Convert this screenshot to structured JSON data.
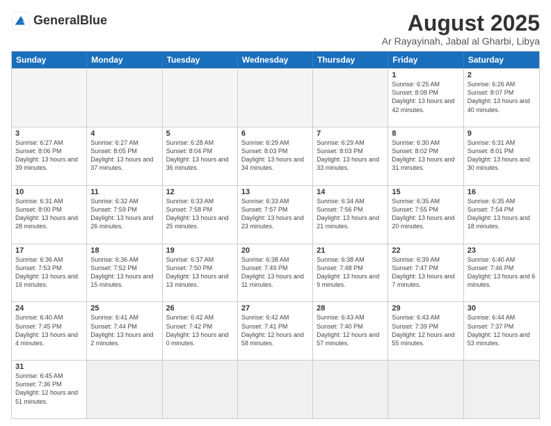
{
  "header": {
    "logo_general": "General",
    "logo_blue": "Blue",
    "month_year": "August 2025",
    "location": "Ar Rayayinah, Jabal al Gharbi, Libya"
  },
  "weekdays": [
    "Sunday",
    "Monday",
    "Tuesday",
    "Wednesday",
    "Thursday",
    "Friday",
    "Saturday"
  ],
  "weeks": [
    [
      {
        "day": "",
        "info": ""
      },
      {
        "day": "",
        "info": ""
      },
      {
        "day": "",
        "info": ""
      },
      {
        "day": "",
        "info": ""
      },
      {
        "day": "",
        "info": ""
      },
      {
        "day": "1",
        "info": "Sunrise: 6:25 AM\nSunset: 8:08 PM\nDaylight: 13 hours and 42 minutes."
      },
      {
        "day": "2",
        "info": "Sunrise: 6:26 AM\nSunset: 8:07 PM\nDaylight: 13 hours and 40 minutes."
      }
    ],
    [
      {
        "day": "3",
        "info": "Sunrise: 6:27 AM\nSunset: 8:06 PM\nDaylight: 13 hours and 39 minutes."
      },
      {
        "day": "4",
        "info": "Sunrise: 6:27 AM\nSunset: 8:05 PM\nDaylight: 13 hours and 37 minutes."
      },
      {
        "day": "5",
        "info": "Sunrise: 6:28 AM\nSunset: 8:04 PM\nDaylight: 13 hours and 36 minutes."
      },
      {
        "day": "6",
        "info": "Sunrise: 6:29 AM\nSunset: 8:03 PM\nDaylight: 13 hours and 34 minutes."
      },
      {
        "day": "7",
        "info": "Sunrise: 6:29 AM\nSunset: 8:03 PM\nDaylight: 13 hours and 33 minutes."
      },
      {
        "day": "8",
        "info": "Sunrise: 6:30 AM\nSunset: 8:02 PM\nDaylight: 13 hours and 31 minutes."
      },
      {
        "day": "9",
        "info": "Sunrise: 6:31 AM\nSunset: 8:01 PM\nDaylight: 13 hours and 30 minutes."
      }
    ],
    [
      {
        "day": "10",
        "info": "Sunrise: 6:31 AM\nSunset: 8:00 PM\nDaylight: 13 hours and 28 minutes."
      },
      {
        "day": "11",
        "info": "Sunrise: 6:32 AM\nSunset: 7:59 PM\nDaylight: 13 hours and 26 minutes."
      },
      {
        "day": "12",
        "info": "Sunrise: 6:33 AM\nSunset: 7:58 PM\nDaylight: 13 hours and 25 minutes."
      },
      {
        "day": "13",
        "info": "Sunrise: 6:33 AM\nSunset: 7:57 PM\nDaylight: 13 hours and 23 minutes."
      },
      {
        "day": "14",
        "info": "Sunrise: 6:34 AM\nSunset: 7:56 PM\nDaylight: 13 hours and 21 minutes."
      },
      {
        "day": "15",
        "info": "Sunrise: 6:35 AM\nSunset: 7:55 PM\nDaylight: 13 hours and 20 minutes."
      },
      {
        "day": "16",
        "info": "Sunrise: 6:35 AM\nSunset: 7:54 PM\nDaylight: 13 hours and 18 minutes."
      }
    ],
    [
      {
        "day": "17",
        "info": "Sunrise: 6:36 AM\nSunset: 7:53 PM\nDaylight: 13 hours and 16 minutes."
      },
      {
        "day": "18",
        "info": "Sunrise: 6:36 AM\nSunset: 7:52 PM\nDaylight: 13 hours and 15 minutes."
      },
      {
        "day": "19",
        "info": "Sunrise: 6:37 AM\nSunset: 7:50 PM\nDaylight: 13 hours and 13 minutes."
      },
      {
        "day": "20",
        "info": "Sunrise: 6:38 AM\nSunset: 7:49 PM\nDaylight: 13 hours and 11 minutes."
      },
      {
        "day": "21",
        "info": "Sunrise: 6:38 AM\nSunset: 7:48 PM\nDaylight: 13 hours and 9 minutes."
      },
      {
        "day": "22",
        "info": "Sunrise: 6:39 AM\nSunset: 7:47 PM\nDaylight: 13 hours and 7 minutes."
      },
      {
        "day": "23",
        "info": "Sunrise: 6:40 AM\nSunset: 7:46 PM\nDaylight: 13 hours and 6 minutes."
      }
    ],
    [
      {
        "day": "24",
        "info": "Sunrise: 6:40 AM\nSunset: 7:45 PM\nDaylight: 13 hours and 4 minutes."
      },
      {
        "day": "25",
        "info": "Sunrise: 6:41 AM\nSunset: 7:44 PM\nDaylight: 13 hours and 2 minutes."
      },
      {
        "day": "26",
        "info": "Sunrise: 6:42 AM\nSunset: 7:42 PM\nDaylight: 13 hours and 0 minutes."
      },
      {
        "day": "27",
        "info": "Sunrise: 6:42 AM\nSunset: 7:41 PM\nDaylight: 12 hours and 58 minutes."
      },
      {
        "day": "28",
        "info": "Sunrise: 6:43 AM\nSunset: 7:40 PM\nDaylight: 12 hours and 57 minutes."
      },
      {
        "day": "29",
        "info": "Sunrise: 6:43 AM\nSunset: 7:39 PM\nDaylight: 12 hours and 55 minutes."
      },
      {
        "day": "30",
        "info": "Sunrise: 6:44 AM\nSunset: 7:37 PM\nDaylight: 12 hours and 53 minutes."
      }
    ],
    [
      {
        "day": "31",
        "info": "Sunrise: 6:45 AM\nSunset: 7:36 PM\nDaylight: 12 hours and 51 minutes."
      },
      {
        "day": "",
        "info": ""
      },
      {
        "day": "",
        "info": ""
      },
      {
        "day": "",
        "info": ""
      },
      {
        "day": "",
        "info": ""
      },
      {
        "day": "",
        "info": ""
      },
      {
        "day": "",
        "info": ""
      }
    ]
  ]
}
